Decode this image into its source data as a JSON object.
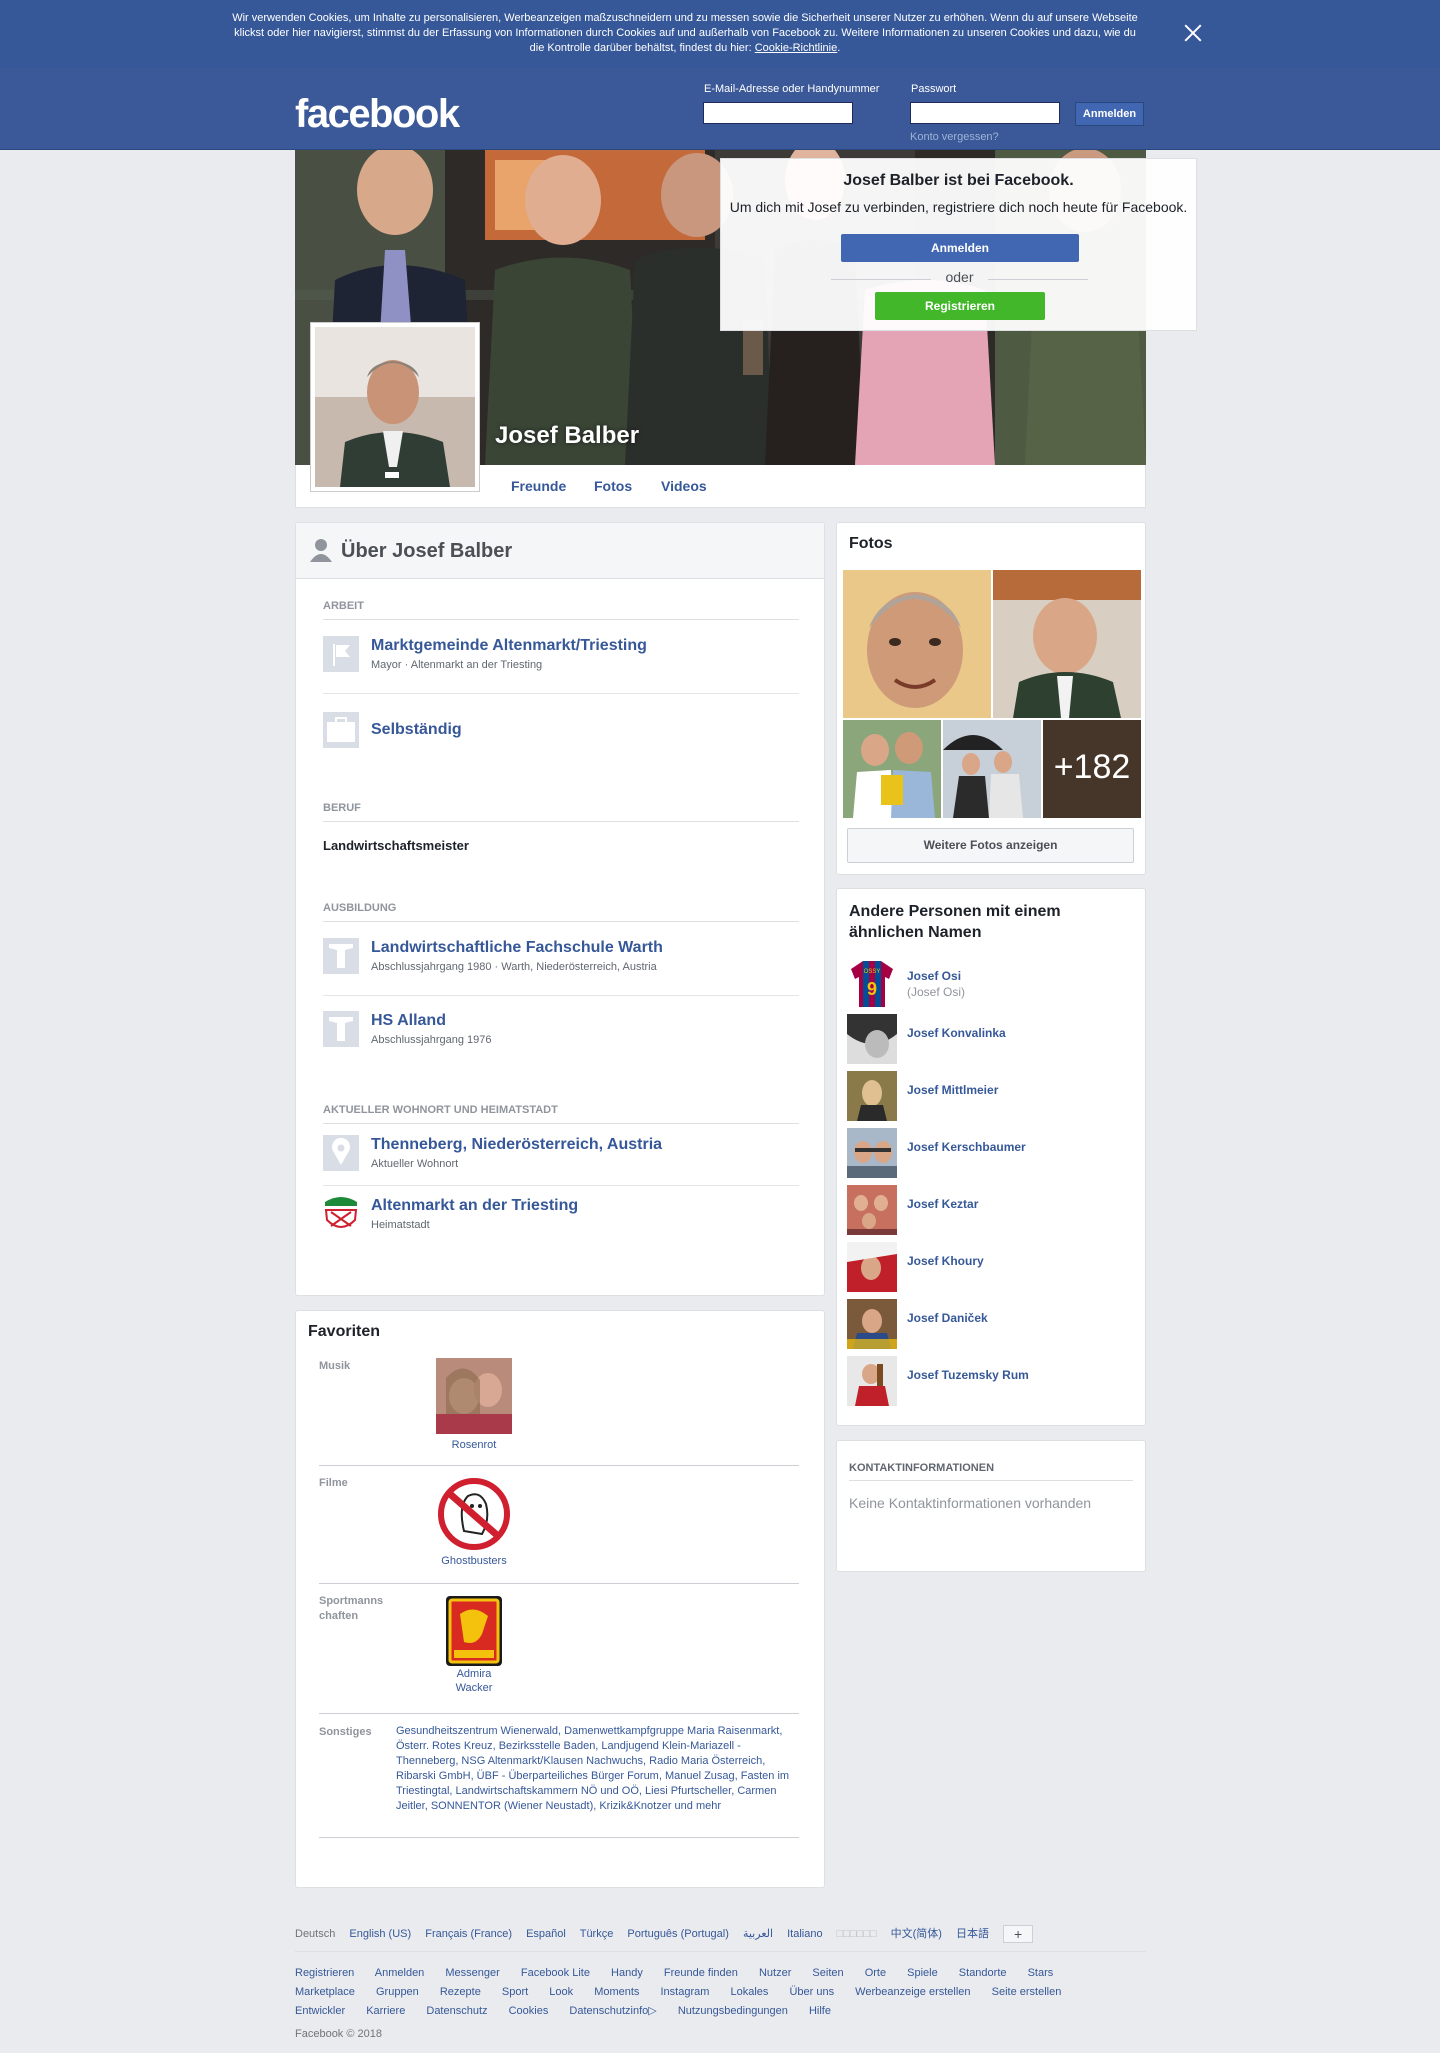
{
  "cookie_banner": {
    "text": "Wir verwenden Cookies, um Inhalte zu personalisieren, Werbeanzeigen maßzuschneidern und zu messen sowie die Sicherheit unserer Nutzer zu erhöhen. Wenn du auf unsere Webseite klickst oder hier navigierst, stimmst du der Erfassung von Informationen durch Cookies auf und außerhalb von Facebook zu. Weitere Informationen zu unseren Cookies und dazu, wie du die Kontrolle darüber behältst, findest du hier: ",
    "link": "Cookie-Richtlinie",
    "end": "."
  },
  "header": {
    "logo": "facebook",
    "email_label": "E-Mail-Adresse oder Handynummer",
    "password_label": "Passwort",
    "login_button": "Anmelden",
    "forgot": "Konto vergessen?"
  },
  "signup_box": {
    "title": "Josef Balber ist bei Facebook.",
    "text": "Um dich mit Josef zu verbinden, registriere dich noch heute für Facebook.",
    "login": "Anmelden",
    "or": "oder",
    "register": "Registrieren"
  },
  "profile": {
    "name": "Josef Balber",
    "tabs": [
      "Freunde",
      "Fotos",
      "Videos"
    ]
  },
  "about": {
    "title": "Über Josef Balber",
    "work_header": "ARBEIT",
    "work": [
      {
        "title": "Marktgemeinde Altenmarkt/Triesting",
        "sub": "Mayor · Altenmarkt an der Triesting"
      },
      {
        "title": "Selbständig",
        "sub": ""
      }
    ],
    "profession_header": "BERUF",
    "profession": "Landwirtschaftsmeister",
    "education_header": "AUSBILDUNG",
    "education": [
      {
        "title": "Landwirtschaftliche Fachschule Warth",
        "sub": "Abschlussjahrgang 1980 · Warth, Niederösterreich, Austria"
      },
      {
        "title": "HS Alland",
        "sub": "Abschlussjahrgang 1976"
      }
    ],
    "places_header": "AKTUELLER WOHNORT UND HEIMATSTADT",
    "places": [
      {
        "title": "Thenneberg, Niederösterreich, Austria",
        "sub": "Aktueller Wohnort"
      },
      {
        "title": "Altenmarkt an der Triesting",
        "sub": "Heimatstadt"
      }
    ]
  },
  "favorites": {
    "title": "Favoriten",
    "music_label": "Musik",
    "music": "Rosenrot",
    "movies_label": "Filme",
    "movies": "Ghostbusters",
    "sports_label_1": "Sportmanns",
    "sports_label_2": "chaften",
    "sports_1": "Admira",
    "sports_2": "Wacker",
    "other_label": "Sonstiges",
    "other": "Gesundheitszentrum Wienerwald, Damenwettkampfgruppe Maria Raisenmarkt, Österr. Rotes Kreuz, Bezirksstelle Baden, Landjugend Klein-Mariazell - Thenneberg, NSG Altenmarkt/Klausen Nachwuchs, Radio Maria Österreich, Ribarski GmbH, ÜBF - Überparteiliches Bürger Forum, Manuel Zusag, Fasten im Triestingtal, Landwirtschaftskammern NÖ und OÖ, Liesi Pfurtscheller, Carmen Jeitler, SONNENTOR (Wiener Neustadt), Krizik&Knotzer und mehr"
  },
  "photos": {
    "title": "Fotos",
    "more_count": "+182",
    "more_button": "Weitere Fotos anzeigen"
  },
  "others": {
    "title_1": "Andere Personen mit einem",
    "title_2": "ähnlichen Namen",
    "people": [
      {
        "name": "Josef Osi",
        "sub": "(Josef Osi)"
      },
      {
        "name": "Josef Konvalinka",
        "sub": ""
      },
      {
        "name": "Josef Mittlmeier",
        "sub": ""
      },
      {
        "name": "Josef Kerschbaumer",
        "sub": ""
      },
      {
        "name": "Josef Keztar",
        "sub": ""
      },
      {
        "name": "Josef Khoury",
        "sub": ""
      },
      {
        "name": "Josef Daniček",
        "sub": ""
      },
      {
        "name": "Josef Tuzemsky Rum",
        "sub": ""
      }
    ],
    "jersey_number": "9",
    "jersey_name": "OSSY"
  },
  "contact": {
    "title": "KONTAKTINFORMATIONEN",
    "text": "Keine Kontaktinformationen vorhanden"
  },
  "footer": {
    "languages": [
      "Deutsch",
      "English (US)",
      "Français (France)",
      "Español",
      "Türkçe",
      "Português (Portugal)",
      "العربية",
      "Italiano",
      "□□□□□□",
      "中文(简体)",
      "日本語"
    ],
    "plus": "+",
    "links": [
      "Registrieren",
      "Anmelden",
      "Messenger",
      "Facebook Lite",
      "Handy",
      "Freunde finden",
      "Nutzer",
      "Seiten",
      "Orte",
      "Spiele",
      "Standorte",
      "Stars",
      "Marketplace",
      "Gruppen",
      "Rezepte",
      "Sport",
      "Look",
      "Moments",
      "Instagram",
      "Lokales",
      "Über uns",
      "Werbeanzeige erstellen",
      "Seite erstellen",
      "Entwickler",
      "Karriere",
      "Datenschutz",
      "Cookies",
      "Datenschutzinfo▷",
      "Nutzungsbedingungen",
      "Hilfe"
    ],
    "copyright": "Facebook © 2018"
  },
  "colors": {
    "brand": "#3b5998",
    "link": "#365899",
    "green": "#42b72a",
    "background": "#e9ebee"
  }
}
